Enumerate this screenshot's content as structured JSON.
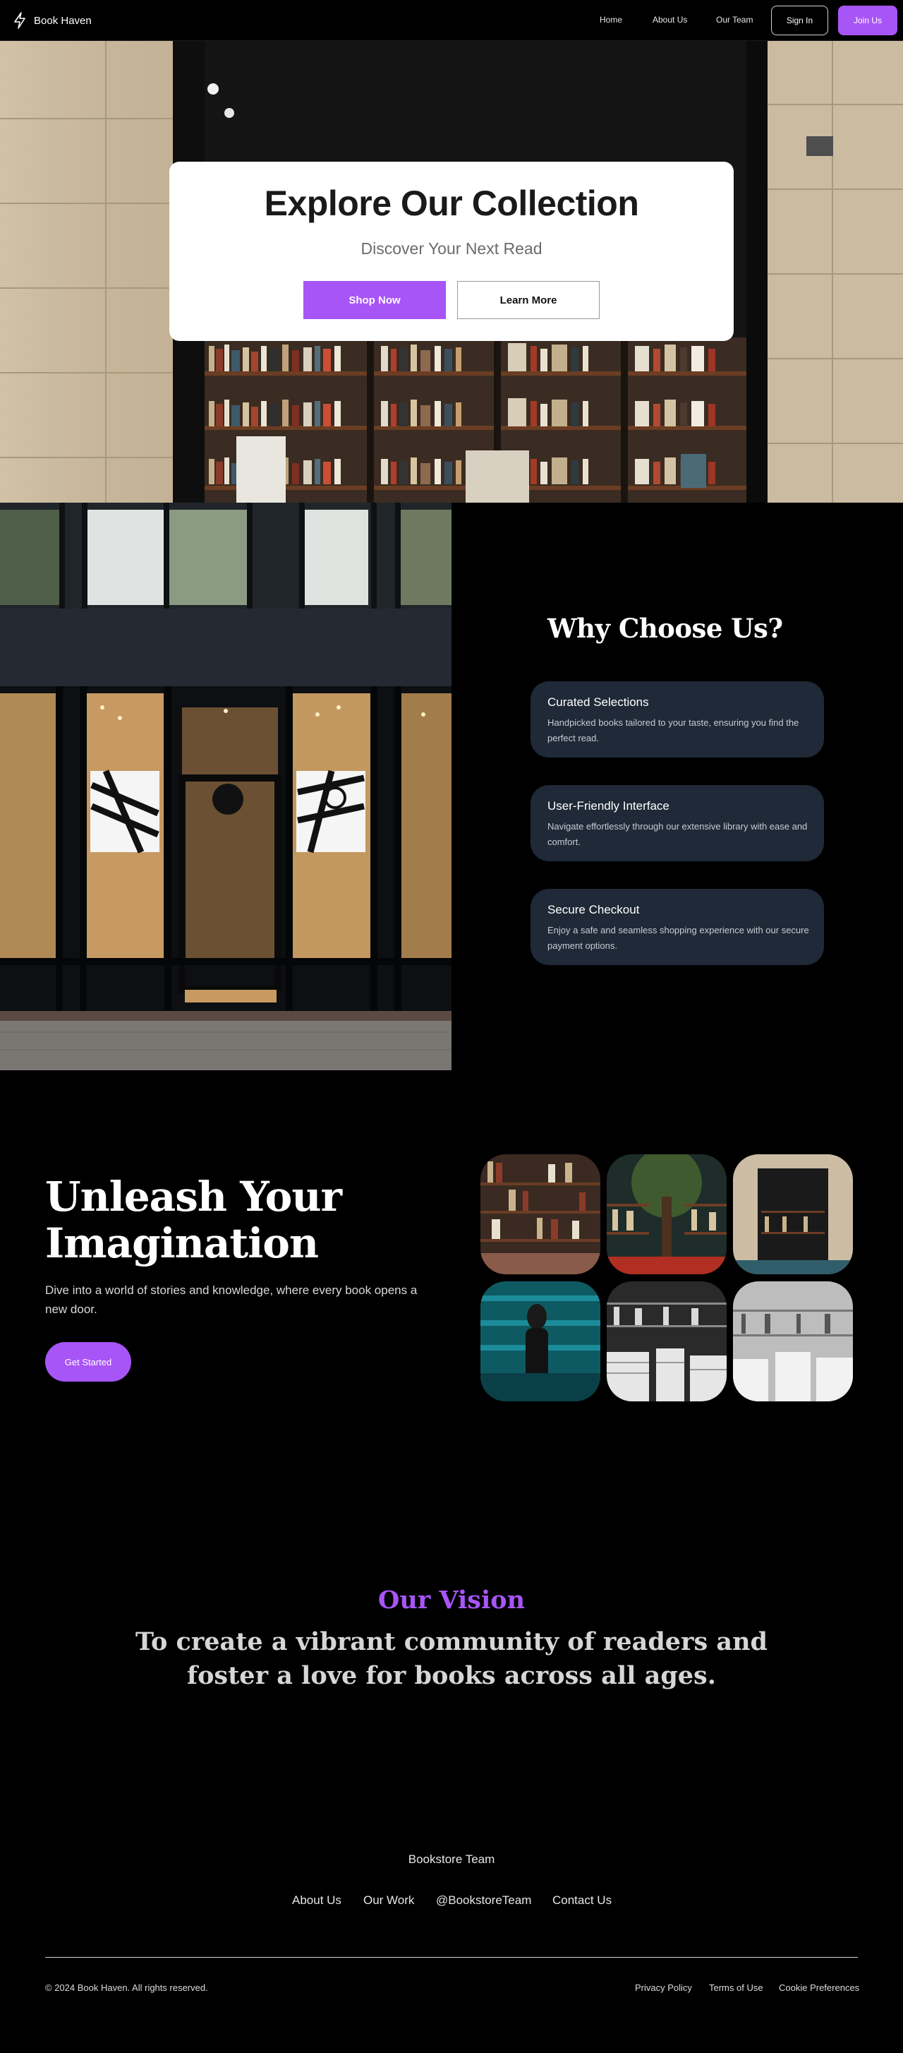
{
  "nav": {
    "brand": "Book Haven",
    "logo_icon": "lightning-bolt-icon",
    "links": [
      "Home",
      "About Us",
      "Our Team"
    ],
    "sign_in": "Sign In",
    "join": "Join Us"
  },
  "hero": {
    "title": "Explore Our Collection",
    "subtitle": "Discover Your Next Read",
    "primary_button": "Shop Now",
    "secondary_button": "Learn More"
  },
  "why": {
    "title": "Why Choose Us?",
    "features": [
      {
        "title": "Curated Selections",
        "description": "Handpicked books tailored to your taste, ensuring you find the perfect read."
      },
      {
        "title": "User-Friendly Interface",
        "description": "Navigate effortlessly through our extensive library with ease and comfort."
      },
      {
        "title": "Secure Checkout",
        "description": "Enjoy a safe and seamless shopping experience with our secure payment options."
      }
    ]
  },
  "unleash": {
    "title": "Unleash Your Imagination",
    "description": "Dive into a world of stories and knowledge, where every book opens a new door.",
    "button": "Get Started"
  },
  "vision": {
    "label": "Our Vision",
    "text": "To create a vibrant community of readers and foster a love for books across all ages."
  },
  "footer": {
    "team": "Bookstore Team",
    "links": [
      "About Us",
      "Our Work",
      "@BookstoreTeam",
      "Contact Us"
    ],
    "copyright": "© 2024 Book Haven. All rights reserved.",
    "legal": [
      "Privacy Policy",
      "Terms of Use",
      "Cookie Preferences"
    ]
  },
  "colors": {
    "accent": "#a855f7",
    "card_bg": "#1f2937",
    "page_bg": "#000000"
  }
}
